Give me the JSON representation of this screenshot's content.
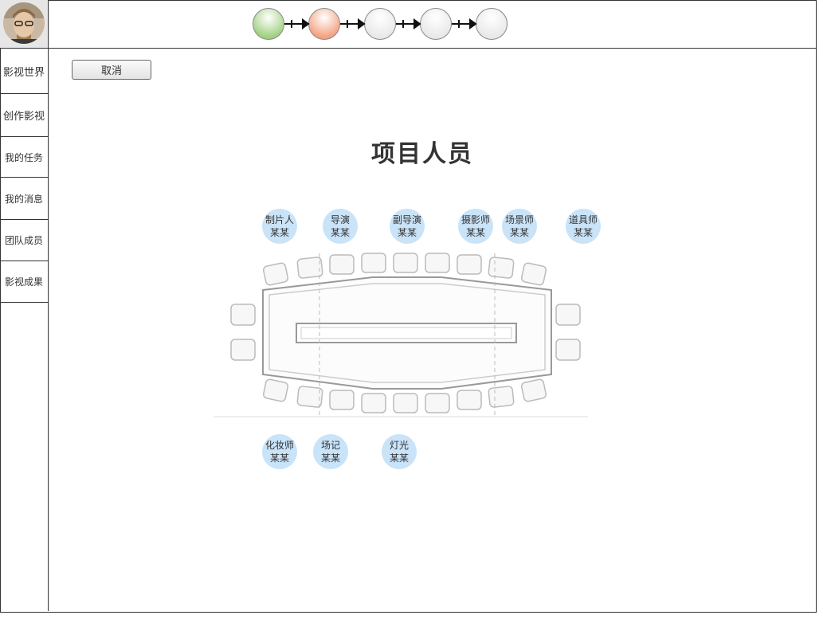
{
  "sidebar": {
    "items": [
      {
        "label": "影视世界"
      },
      {
        "label": "创作影视"
      },
      {
        "label": "我的任务"
      },
      {
        "label": "我的消息"
      },
      {
        "label": "团队成员"
      },
      {
        "label": "影视成果"
      }
    ]
  },
  "steps": {
    "colors": [
      "#9fd07f",
      "#f4a07f",
      "#e8e8e8",
      "#e8e8e8",
      "#e8e8e8"
    ]
  },
  "toolbar": {
    "cancel_label": "取消"
  },
  "main": {
    "title": "项目人员"
  },
  "crew_top": [
    {
      "role": "制片人",
      "name": "某某"
    },
    {
      "role": "导演",
      "name": "某某"
    },
    {
      "role": "副导演",
      "name": "某某"
    },
    {
      "role": "摄影师",
      "name": "某某"
    },
    {
      "role": "场景师",
      "name": "某某"
    },
    {
      "role": "道具师",
      "name": "某某"
    }
  ],
  "crew_bottom": [
    {
      "role": "化妆师",
      "name": "某某"
    },
    {
      "role": "场记",
      "name": "某某"
    },
    {
      "role": "灯光",
      "name": "某某"
    }
  ]
}
